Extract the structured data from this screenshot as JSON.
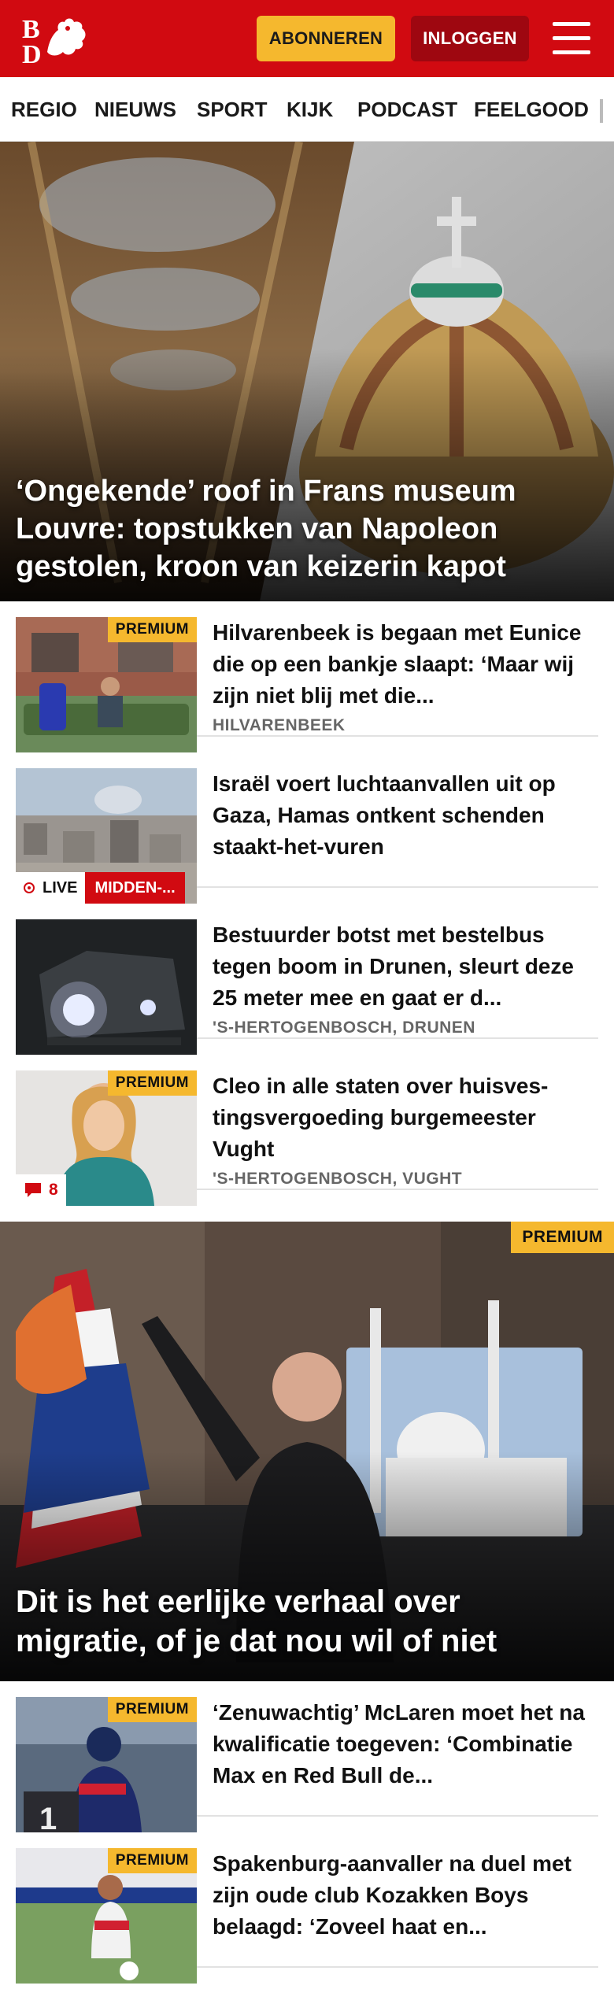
{
  "header": {
    "logo_alt": "BD",
    "subscribe_label": "ABONNEREN",
    "login_label": "INLOGGEN",
    "brand_color": "#d10a11",
    "accent_color": "#f5b82e"
  },
  "nav": {
    "items": [
      "REGIO",
      "NIEUWS",
      "SPORT",
      "KIJK",
      "PODCAST",
      "FEELGOOD"
    ]
  },
  "hero": {
    "title": "‘Ongekende’ roof in Frans museum Louvre: topstukken van Napoleon gestolen, kroon van keizerin kapot"
  },
  "articles": [
    {
      "title": "Hilvarenbeek is begaan met Eunice die op een bankje slaapt: ‘Maar wij zijn niet blij met die...",
      "region": "HILVARENBEEK",
      "badge": "PREMIUM"
    },
    {
      "title": "Israël voert luchtaanvallen uit op Gaza, Hamas ontkent schenden staakt-het-vuren",
      "live_label": "LIVE",
      "category": "MIDDEN-..."
    },
    {
      "title": "Bestuurder botst met bestelbus tegen boom in Drunen, sleurt deze 25 meter mee en gaat er d...",
      "region": "'S-HERTOGENBOSCH, DRUNEN"
    },
    {
      "title": "Cleo in alle staten over huisves­tingsvergoeding burgemeester Vught",
      "region": "'S-HERTOGENBOSCH, VUGHT",
      "badge": "PREMIUM",
      "comment_count": "8"
    }
  ],
  "feature": {
    "badge": "PREMIUM",
    "title": "Dit is het eerlijke verhaal over migratie, of je dat nou wil of niet"
  },
  "articles2": [
    {
      "title": "‘Zenuwachtig’ McLaren moet het na kwalificatie toegeven: ‘Combinatie Max en Red Bull de...",
      "badge": "PREMIUM"
    },
    {
      "title": "Spakenburg-aanvaller na duel met zijn oude club Kozakken Boys belaagd: ‘Zoveel haat en...",
      "badge": "PREMIUM"
    }
  ]
}
